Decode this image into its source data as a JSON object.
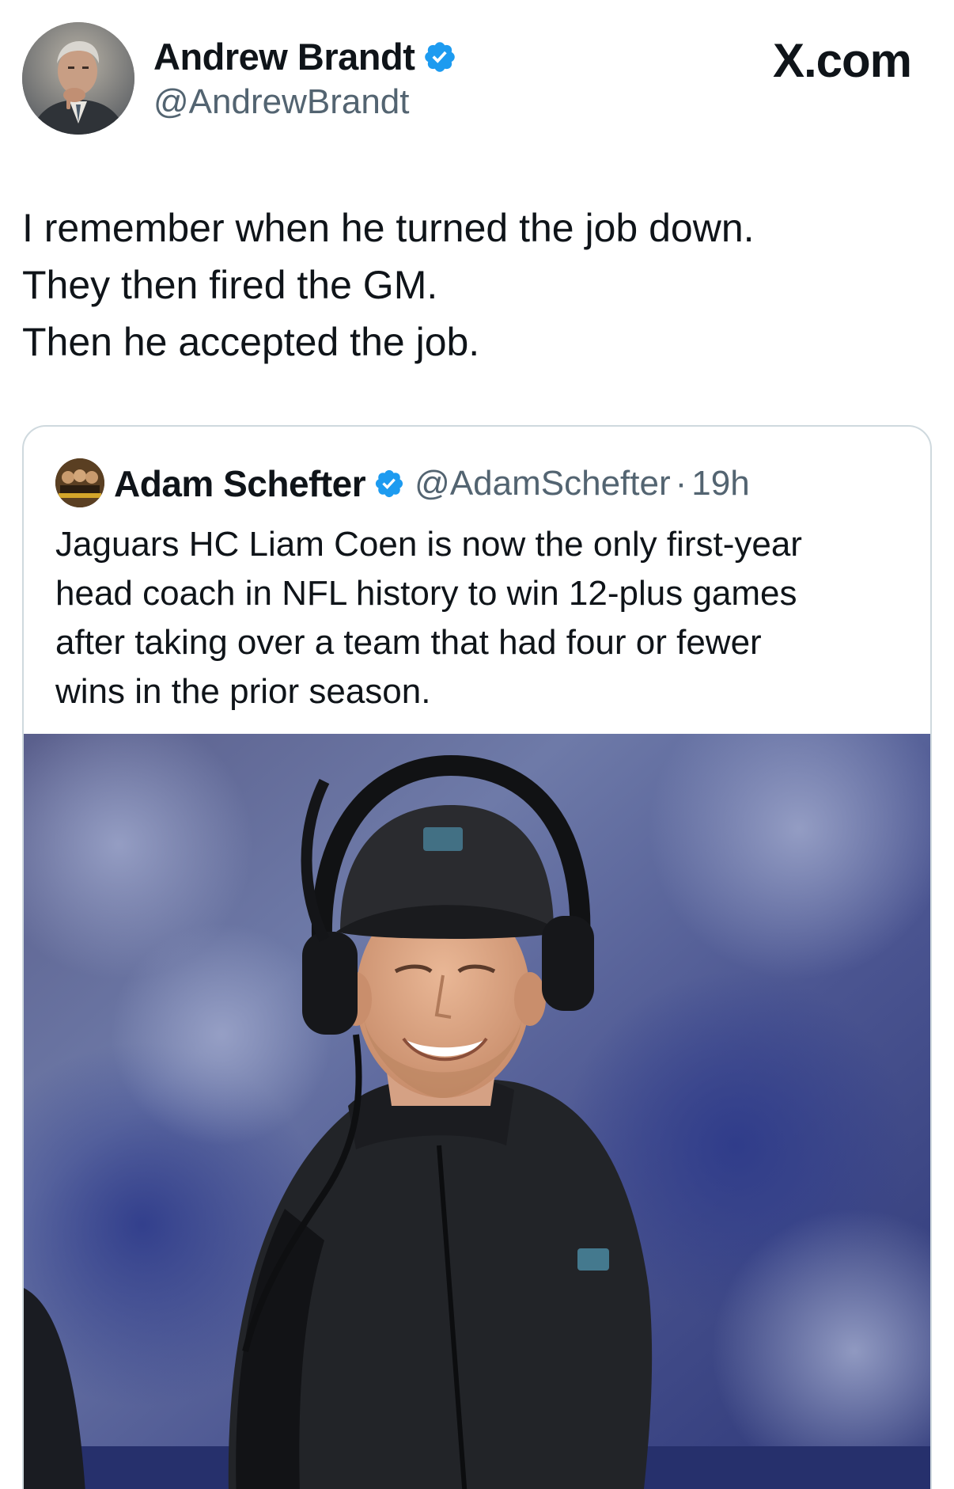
{
  "site": {
    "brand": "X.com"
  },
  "author": {
    "name": "Andrew Brandt",
    "handle": "@AndrewBrandt",
    "verified": true,
    "avatar_icon": "profile-photo-man-thinking"
  },
  "tweet": {
    "lines": [
      "I remember when he turned the job down.",
      "They then fired the GM.",
      "Then he accepted the job."
    ]
  },
  "quoted": {
    "name": "Adam Schefter",
    "handle": "@AdamSchefter",
    "separator": "·",
    "time": "19h",
    "verified": true,
    "lines": [
      "Jaguars HC Liam Coen is now the only first-year",
      "head coach in NFL history to win 12-plus games",
      "after taking over a team that had four or fewer",
      "wins in the prior season."
    ],
    "photo_icon": "coach-with-headset-photo"
  },
  "colors": {
    "verified_blue": "#1d9bf0",
    "secondary_text": "#536471",
    "border": "#cfd9de"
  }
}
